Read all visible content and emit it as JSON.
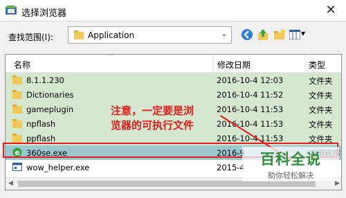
{
  "window": {
    "title": "选择浏览器",
    "close_glyph": "✕"
  },
  "toolbar": {
    "look_in_label": "查找范围(I):",
    "look_in_value": "Application",
    "view_menu_glyph": "▾"
  },
  "list": {
    "columns": [
      "名称",
      "修改日期",
      "类型"
    ],
    "rows": [
      {
        "name": "8.1.1.230",
        "date": "2016-10-4 12:03",
        "type": "文件夹",
        "icon": "folder-icon"
      },
      {
        "name": "Dictionaries",
        "date": "2016-10-4 11:52",
        "type": "文件夹",
        "icon": "folder-icon"
      },
      {
        "name": "gameplugin",
        "date": "2016-10-4 11:53",
        "type": "文件夹",
        "icon": "folder-icon"
      },
      {
        "name": "npflash",
        "date": "2016-10-4 11:53",
        "type": "文件夹",
        "icon": "folder-icon"
      },
      {
        "name": "ppflash",
        "date": "2016-10-4 11:53",
        "type": "文件夹",
        "icon": "folder-icon"
      },
      {
        "name": "360se.exe",
        "date": "2016-9",
        "type": "应用程序",
        "icon": "browser-icon"
      },
      {
        "name": "wow_helper.exe",
        "date": "2015-4",
        "type": "",
        "icon": "exe-icon"
      }
    ]
  },
  "annotation": {
    "line1": "注意，一定要是浏",
    "line2": "览器的可执行文件"
  },
  "watermark": {
    "main": "百科全说",
    "sub": "助你轻松解决"
  },
  "colors": {
    "row_bg": "#d5e8cf",
    "selected_bg": "#9bc7cf",
    "annotation": "#e31b1b",
    "watermark": "#2b8f3c"
  }
}
